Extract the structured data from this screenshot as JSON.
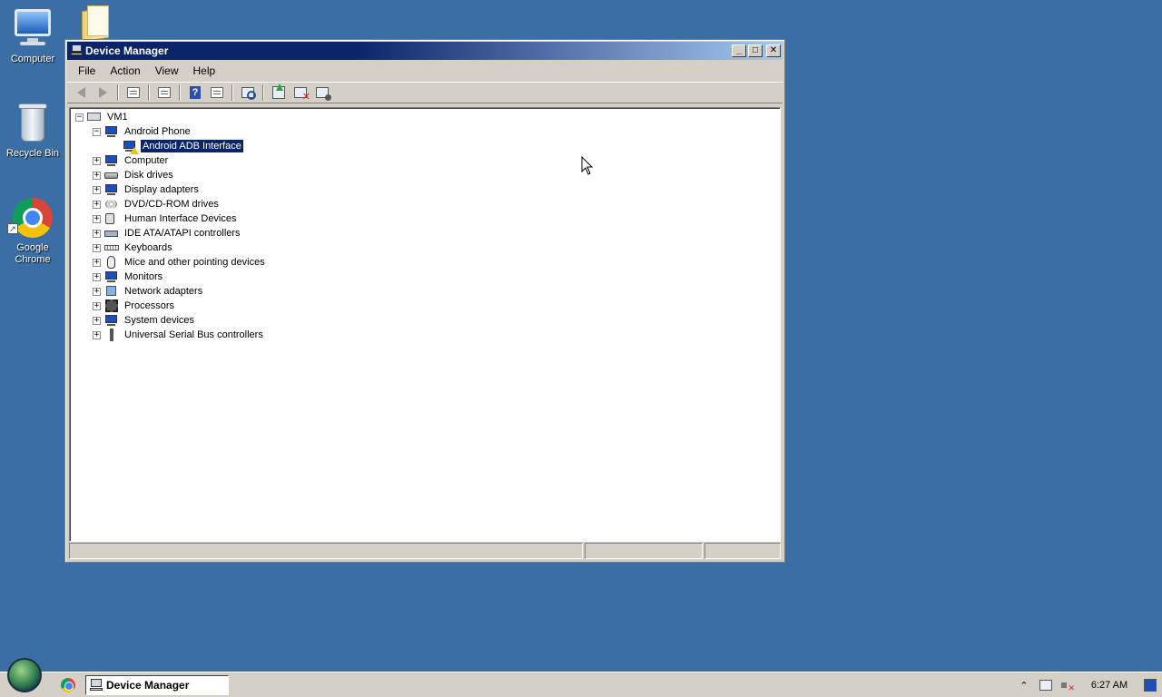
{
  "desktop": {
    "icons": [
      {
        "label": "Computer"
      },
      {
        "label": "Recycle Bin"
      },
      {
        "label": "Google Chrome"
      }
    ]
  },
  "window": {
    "title": "Device Manager",
    "controls": {
      "minimize": "_",
      "maximize": "□",
      "close": "✕"
    },
    "menu": [
      "File",
      "Action",
      "View",
      "Help"
    ],
    "toolbar": [
      "back",
      "forward",
      "show-hide-console-tree",
      "properties",
      "help",
      "action-pane",
      "scan-hardware-changes",
      "update-driver",
      "uninstall",
      "disable"
    ],
    "tree": {
      "root": "VM1",
      "expander_expanded": "−",
      "expander_collapsed": "+",
      "android_phone": {
        "label": "Android Phone",
        "child": "Android ADB Interface"
      },
      "categories": [
        "Computer",
        "Disk drives",
        "Display adapters",
        "DVD/CD-ROM drives",
        "Human Interface Devices",
        "IDE ATA/ATAPI controllers",
        "Keyboards",
        "Mice and other pointing devices",
        "Monitors",
        "Network adapters",
        "Processors",
        "System devices",
        "Universal Serial Bus controllers"
      ]
    }
  },
  "taskbar": {
    "task_label": "Device Manager",
    "tray_expand": "⌃",
    "clock": "6:27 AM"
  }
}
